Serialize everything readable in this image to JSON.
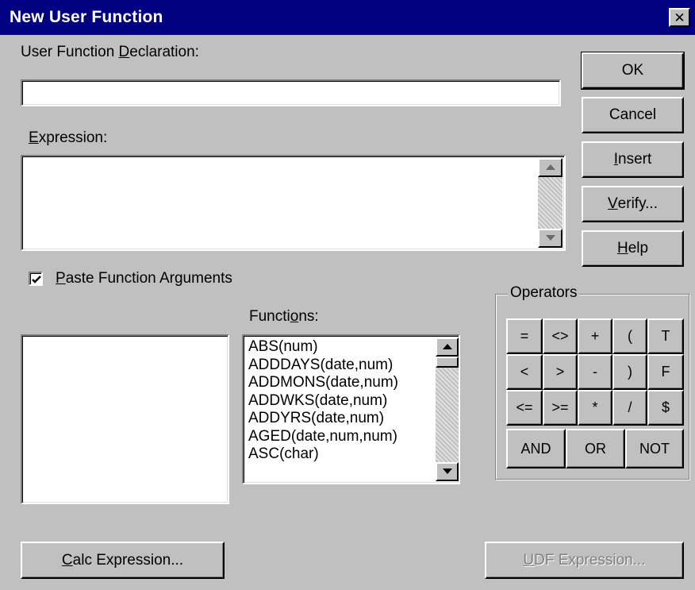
{
  "window": {
    "title": "New User Function",
    "close_glyph": "✕"
  },
  "declaration": {
    "label_pre": "User Function ",
    "label_key": "D",
    "label_post": "eclaration:",
    "value": ""
  },
  "expression": {
    "label_key": "E",
    "label_post": "xpression:",
    "value": ""
  },
  "paste_args": {
    "label_key": "P",
    "label_post": "aste Function Arguments",
    "checked": true
  },
  "functions": {
    "label_pre": "Functi",
    "label_key": "o",
    "label_post": "ns:",
    "items": [
      "ABS(num)",
      "ADDDAYS(date,num)",
      "ADDMONS(date,num)",
      "ADDWKS(date,num)",
      "ADDYRS(date,num)",
      "AGED(date,num,num)",
      "ASC(char)"
    ]
  },
  "buttons": {
    "ok": "OK",
    "cancel": "Cancel",
    "insert_key": "I",
    "insert_post": "nsert",
    "verify_key": "V",
    "verify_post": "erify...",
    "help_key": "H",
    "help_post": "elp",
    "calc_key": "C",
    "calc_post": "alc Expression...",
    "udf_key": "U",
    "udf_post": "DF Expression..."
  },
  "operators": {
    "label": "Operators",
    "row1": [
      "=",
      "<>",
      "+",
      "(",
      "T"
    ],
    "row2": [
      "<",
      ">",
      "-",
      ")",
      "F"
    ],
    "row3": [
      "<=",
      ">=",
      "*",
      "/",
      "$"
    ],
    "row4": [
      "AND",
      "OR",
      "NOT"
    ]
  }
}
